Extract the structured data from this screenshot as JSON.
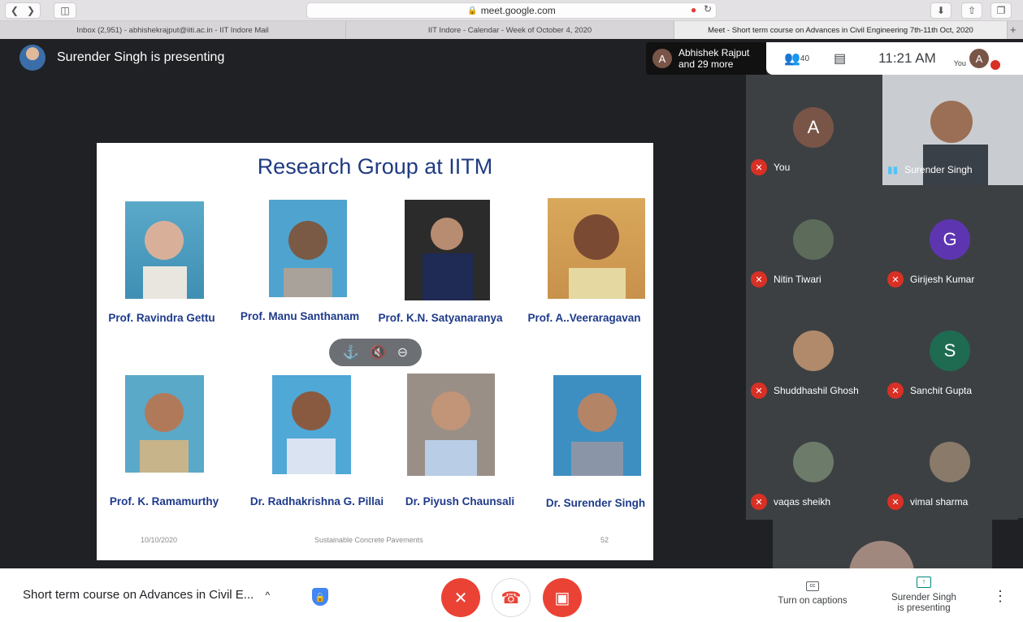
{
  "browser": {
    "url": "meet.google.com",
    "tabs": [
      "Inbox (2,951) - abhishekrajput@iiti.ac.in - IIT Indore Mail",
      "IIT Indore - Calendar - Week of October 4, 2020",
      "Meet - Short term course on Advances in Civil Engineering 7th-11th Oct, 2020"
    ]
  },
  "meet": {
    "presenter_banner": "Surender Singh is presenting",
    "people_chip": {
      "avatar": "A",
      "line1": "Abhishek Rajput",
      "line2": "and 29 more"
    },
    "participant_count": "40",
    "time": "11:21 AM",
    "self_label": "You",
    "self_avatar": "A"
  },
  "slide": {
    "title": "Research Group at IITM",
    "people_row1": [
      "Prof. Ravindra Gettu",
      "Prof. Manu Santhanam",
      "Prof. K.N. Satyanaranya",
      "Prof. A..Veeraragavan"
    ],
    "people_row2": [
      "Prof. K. Ramamurthy",
      "Dr. Radhakrishna G. Pillai",
      "Dr. Piyush Chaunsali",
      "Dr. Surender Singh"
    ],
    "footer_date": "10/10/2020",
    "footer_title": "Sustainable Concrete Pavements",
    "footer_page": "52"
  },
  "tiles": [
    {
      "name": "You",
      "avatar": "A",
      "color": "#795548",
      "muted": true
    },
    {
      "name": "Surender Singh",
      "avatar": "",
      "color": "",
      "muted": false
    },
    {
      "name": "Nitin Tiwari",
      "avatar": "",
      "color": "#5c6b5a",
      "muted": true
    },
    {
      "name": "Girijesh Kumar",
      "avatar": "G",
      "color": "#5e35b1",
      "muted": true
    },
    {
      "name": "Shuddhashil Ghosh",
      "avatar": "",
      "color": "#b08a6a",
      "muted": true
    },
    {
      "name": "Sanchit Gupta",
      "avatar": "S",
      "color": "#1e6b52",
      "muted": true
    },
    {
      "name": "vaqas sheikh",
      "avatar": "",
      "color": "#6d7b6a",
      "muted": true
    },
    {
      "name": "vimal sharma",
      "avatar": "",
      "color": "#8a7a6a",
      "muted": true
    }
  ],
  "bottom": {
    "meeting_title": "Short term course on Advances in Civil E...",
    "captions": "Turn on captions",
    "presenting_line1": "Surender Singh",
    "presenting_line2": "is presenting"
  },
  "colors": {
    "stage": "#202124",
    "danger": "#ea4335",
    "slide_text": "#1e3a8a"
  }
}
